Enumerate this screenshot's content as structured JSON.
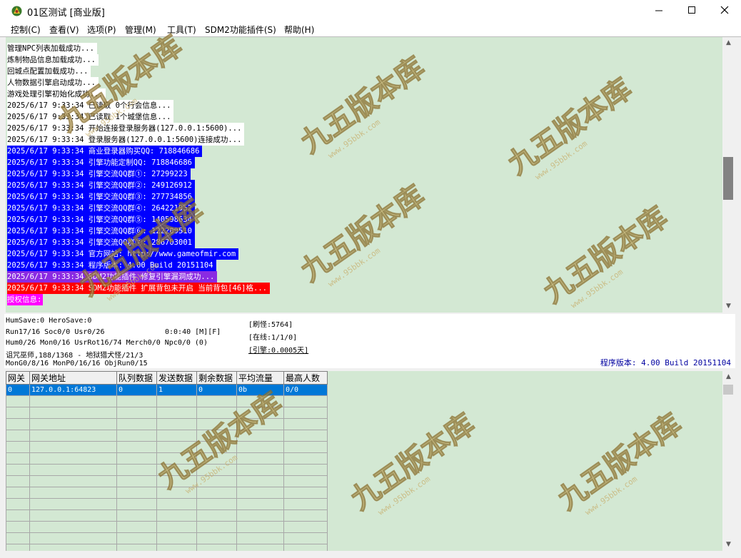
{
  "window": {
    "title": "01区测试 [商业版]",
    "controls": [
      "minimize",
      "maximize",
      "close"
    ]
  },
  "menu": [
    "控制(C)",
    "查看(V)",
    "选项(P)",
    "管理(M)",
    "工具(T)",
    "SDM2功能插件(S)",
    "帮助(H)"
  ],
  "log": [
    {
      "text": "管理NPC列表加载成功...",
      "bg": "#ffffff",
      "color": "#000000"
    },
    {
      "text": "炼制物品信息加载成功...",
      "bg": "#ffffff",
      "color": "#000000"
    },
    {
      "text": "回城点配置加载成功...",
      "bg": "#ffffff",
      "color": "#000000"
    },
    {
      "text": "人物数据引擎启动成功...",
      "bg": "#ffffff",
      "color": "#000000"
    },
    {
      "text": "游戏处理引擎初始化成功...",
      "bg": "#ffffff",
      "color": "#000000"
    },
    {
      "text": "2025/6/17 9:33:34 已读取 0个行会信息...",
      "bg": "#ffffff",
      "color": "#000000"
    },
    {
      "text": "2025/6/17 9:33:34 已读取 1个城堡信息...",
      "bg": "#ffffff",
      "color": "#000000"
    },
    {
      "text": "2025/6/17 9:33:34 开始连接登录服务器(127.0.0.1:5600)...",
      "bg": "#ffffff",
      "color": "#000000"
    },
    {
      "text": "2025/6/17 9:33:34 登录服务器(127.0.0.1:5600)连接成功...",
      "bg": "#ffffff",
      "color": "#000000"
    },
    {
      "text": "2025/6/17 9:33:34 商业登录器购买QQ: 718846686",
      "bg": "#0000ff",
      "color": "#ffffff"
    },
    {
      "text": "2025/6/17 9:33:34 引擎功能定制QQ: 718846686",
      "bg": "#0000ff",
      "color": "#ffffff"
    },
    {
      "text": "2025/6/17 9:33:34 引擎交流QQ群①: 27299223",
      "bg": "#0000ff",
      "color": "#ffffff"
    },
    {
      "text": "2025/6/17 9:33:34 引擎交流QQ群②: 249126912",
      "bg": "#0000ff",
      "color": "#ffffff"
    },
    {
      "text": "2025/6/17 9:33:34 引擎交流QQ群③: 277734856",
      "bg": "#0000ff",
      "color": "#ffffff"
    },
    {
      "text": "2025/6/17 9:33:34 引擎交流QQ群④: 264221952",
      "bg": "#0000ff",
      "color": "#ffffff"
    },
    {
      "text": "2025/6/17 9:33:34 引擎交流QQ群⑤: 140598634",
      "bg": "#0000ff",
      "color": "#ffffff"
    },
    {
      "text": "2025/6/17 9:33:34 引擎交流QQ群⑥: 122209510",
      "bg": "#0000ff",
      "color": "#ffffff"
    },
    {
      "text": "2025/6/17 9:33:34 引擎交流QQ群⑦: 286703001",
      "bg": "#0000ff",
      "color": "#ffffff"
    },
    {
      "text": "2025/6/17 9:33:34 官方网站: http://www.gameofmir.com",
      "bg": "#0000ff",
      "color": "#ffffff"
    },
    {
      "text": "2025/6/17 9:33:34 程序版本: 4.00 Build 20151104",
      "bg": "#0000ff",
      "color": "#ffffff"
    },
    {
      "text": "2025/6/17 9:33:34 SDM2功能插件 修复引擎漏洞成功...",
      "bg": "#8a2be2",
      "color": "#ffffff"
    },
    {
      "text": "2025/6/17 9:33:34 SDM2功能插件 扩展背包未开启 当前背包[46]格...",
      "bg": "#ff0000",
      "color": "#ffffff"
    },
    {
      "text": "授权信息:",
      "bg": "#ff00ff",
      "color": "#ffffff"
    }
  ],
  "status": {
    "line1": "HumSave:0 HeroSave:0",
    "line2": "Run17/16 Soc0/0 Usr0/26",
    "timer": "0:0:40 [M][F]",
    "line3": "Hum0/26 Mon0/16 UsrRot16/74 Merch0/0 Npc0/0 (0)",
    "line4": "诅咒巫师,188/1368 - 地狱猎犬怪/21/3",
    "line5": "MonG0/8/16 MonP0/16/16 ObjRun0/15",
    "refresh": "[刷怪:5764]",
    "online": "[在线:1/1/0]",
    "engine": "[引擎:0.0005天]",
    "version": "程序版本: 4.00 Build 20151104"
  },
  "grid": {
    "headers": [
      "网关",
      "网关地址",
      "队列数据",
      "发送数据",
      "剩余数据",
      "平均流量",
      "最高人数"
    ],
    "rows": [
      [
        "0",
        "127.0.0.1:64823",
        "0",
        "1",
        "0",
        "0b",
        "0/0"
      ]
    ]
  },
  "watermark": {
    "text": "九五版本库",
    "url": "www.95bbk.com",
    "color": "#d9c27a"
  },
  "colors": {
    "panel_bg": "#d3e8d3",
    "selection": "#0078d7"
  }
}
